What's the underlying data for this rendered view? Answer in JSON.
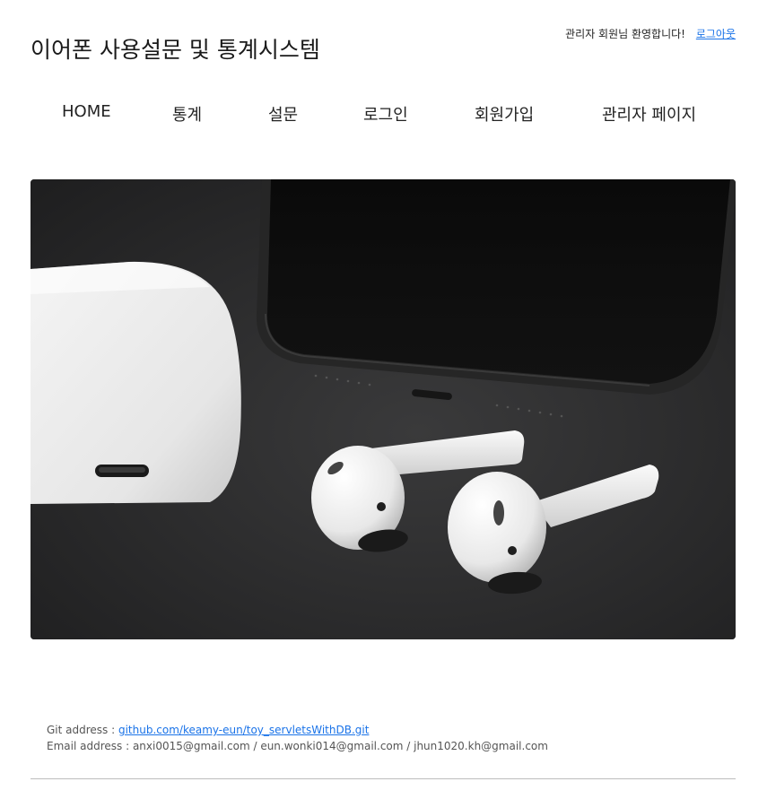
{
  "header": {
    "site_title": "이어폰 사용설문 및 통계시스템",
    "welcome_text": "관리자 회원님 환영합니다!",
    "logout_label": "로그아웃"
  },
  "nav": {
    "items": [
      {
        "label": "HOME"
      },
      {
        "label": "통계"
      },
      {
        "label": "설문"
      },
      {
        "label": "로그인"
      },
      {
        "label": "회원가입"
      },
      {
        "label": "관리자 페이지"
      }
    ]
  },
  "hero": {
    "image_alt": "earbuds-photo"
  },
  "footer": {
    "git_label": "Git address : ",
    "git_link": "github.com/keamy-eun/toy_servletsWithDB.git",
    "email_label": "Email address : ",
    "emails": "anxi0015@gmail.com / eun.wonki014@gmail.com / jhun1020.kh@gmail.com"
  },
  "colors": {
    "link": "#1a73e8",
    "text": "#222222",
    "hero_bg": "#2b2b2c"
  }
}
